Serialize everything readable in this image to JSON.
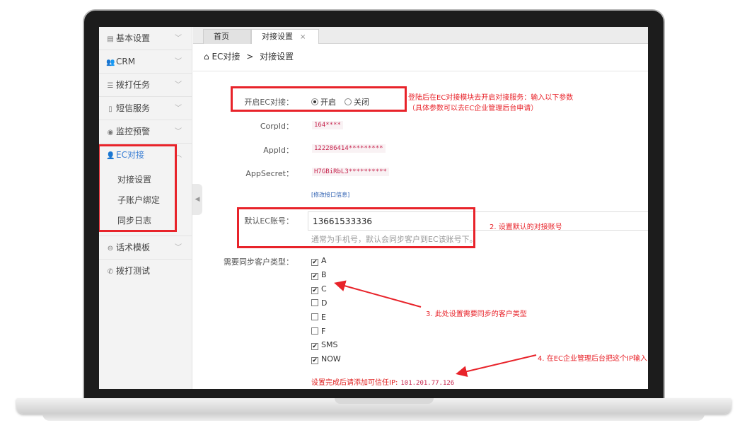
{
  "sidebar": {
    "items": [
      {
        "label": "基本设置",
        "icon": "document-icon"
      },
      {
        "label": "CRM",
        "icon": "users-icon"
      },
      {
        "label": "拨打任务",
        "icon": "list-icon"
      },
      {
        "label": "短信服务",
        "icon": "phone-icon"
      },
      {
        "label": "监控预警",
        "icon": "eye-icon"
      },
      {
        "label": "EC对接",
        "icon": "user-link-icon"
      },
      {
        "label": "话术模板",
        "icon": "chat-icon"
      },
      {
        "label": "拨打测试",
        "icon": "call-icon"
      }
    ],
    "sub_items": [
      "对接设置",
      "子账户绑定",
      "同步日志"
    ]
  },
  "tabs": {
    "home": "首页",
    "current": "对接设置",
    "close": "×"
  },
  "breadcrumb": {
    "root": "EC对接",
    "sep": ">",
    "current": "对接设置"
  },
  "form": {
    "enable_label": "开启EC对接：",
    "enable_on": "开启",
    "enable_off": "关闭",
    "corpid_label": "CorpId：",
    "corpid_value": "164****",
    "appid_label": "AppId：",
    "appid_value": "122286414*********",
    "appsecret_label": "AppSecret：",
    "appsecret_value": "H7GBiRbL3**********",
    "modify_link": "[修改接口信息]",
    "default_account_label": "默认EC账号：",
    "default_account_value": "13661533336",
    "default_account_hint": "通常为手机号，默认会同步客户到EC该账号下。",
    "sync_types_label": "需要同步客户类型：",
    "sync_types": [
      {
        "label": "A",
        "checked": true
      },
      {
        "label": "B",
        "checked": true
      },
      {
        "label": "C",
        "checked": true
      },
      {
        "label": "D",
        "checked": false
      },
      {
        "label": "E",
        "checked": false
      },
      {
        "label": "F",
        "checked": false
      },
      {
        "label": "SMS",
        "checked": true
      },
      {
        "label": "NOW",
        "checked": true
      }
    ],
    "trusted_ip_text": "设置完成后请添加可信任IP:",
    "trusted_ip_value": "101.201.77.126"
  },
  "annotations": {
    "note1_line1": "登陆后在EC对接模块去开启对接服务：输入以下参数",
    "note1_line2": "（具体参数可以去EC企业管理后台申请）",
    "note2": "2. 设置默认的对接账号",
    "note3": "3. 此处设置需要同步的客户类型",
    "note4": "4. 在EC企业管理后台把这个IP输入"
  },
  "colors": {
    "annotation_red": "#e8232a",
    "accent_blue": "#3b7fd4"
  }
}
